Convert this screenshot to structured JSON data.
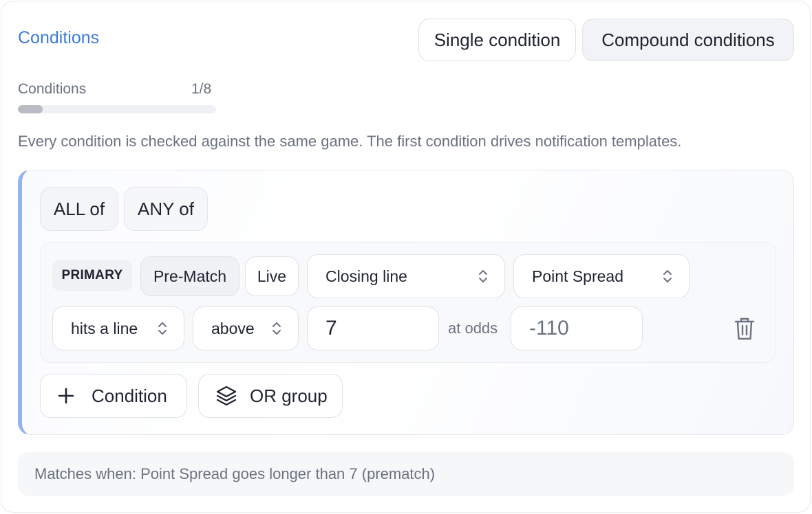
{
  "header": {
    "title": "Conditions",
    "mode_options": [
      "Single condition",
      "Compound conditions"
    ],
    "selected_mode": "Compound conditions"
  },
  "progress": {
    "label": "Conditions",
    "value_text": "1/8",
    "fraction": 0.125
  },
  "help_text": "Every condition is checked against the same game. The first condition drives notification templates.",
  "group": {
    "logic_options": [
      "ALL of",
      "ANY of"
    ],
    "selected_logic": "ALL of",
    "condition": {
      "badge": "PRIMARY",
      "phase_options": [
        "Pre-Match",
        "Live"
      ],
      "selected_phase": "Pre-Match",
      "line_type": "Closing line",
      "market": "Point Spread",
      "trigger": "hits a line",
      "direction": "above",
      "line_value": "7",
      "odds_label": "at odds",
      "odds_value": "-110"
    },
    "actions": {
      "add_condition": "Condition",
      "or_group": "OR group"
    }
  },
  "summary": "Matches when: Point Spread goes longer than 7 (prematch)",
  "colors": {
    "accent": "#3d7bd8",
    "group_border": "#93b4ee",
    "muted_text": "#6b7280"
  },
  "icons": {
    "select_chevron": "chevron-up-down-icon",
    "delete": "trash-icon",
    "add": "plus-icon",
    "or_group": "layers-icon"
  }
}
